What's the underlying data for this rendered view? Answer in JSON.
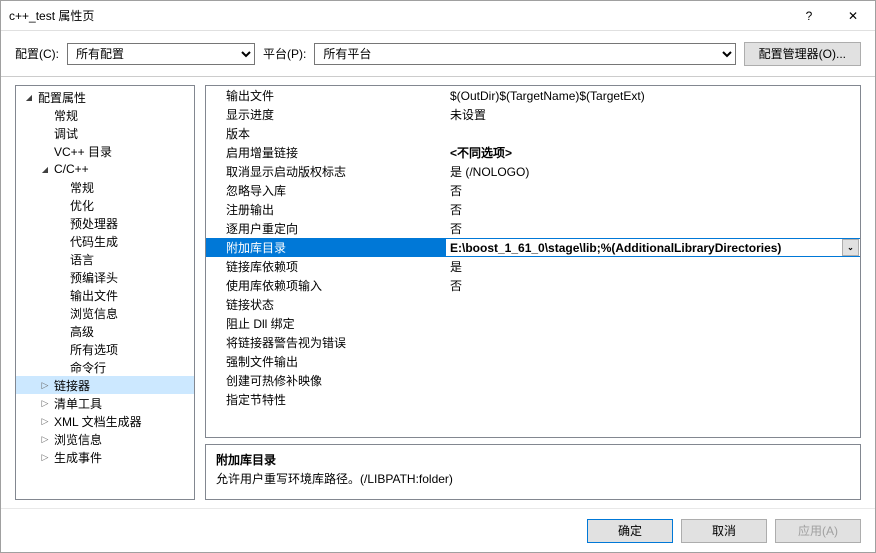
{
  "window": {
    "title": "c++_test 属性页"
  },
  "toolbar": {
    "config_label": "配置(C):",
    "config_value": "所有配置",
    "platform_label": "平台(P):",
    "platform_value": "所有平台",
    "config_mgr": "配置管理器(O)..."
  },
  "tree": [
    {
      "label": "配置属性",
      "depth": 0,
      "tw": "open"
    },
    {
      "label": "常规",
      "depth": 1,
      "tw": ""
    },
    {
      "label": "调试",
      "depth": 1,
      "tw": ""
    },
    {
      "label": "VC++ 目录",
      "depth": 1,
      "tw": ""
    },
    {
      "label": "C/C++",
      "depth": 1,
      "tw": "open"
    },
    {
      "label": "常规",
      "depth": 2,
      "tw": ""
    },
    {
      "label": "优化",
      "depth": 2,
      "tw": ""
    },
    {
      "label": "预处理器",
      "depth": 2,
      "tw": ""
    },
    {
      "label": "代码生成",
      "depth": 2,
      "tw": ""
    },
    {
      "label": "语言",
      "depth": 2,
      "tw": ""
    },
    {
      "label": "预编译头",
      "depth": 2,
      "tw": ""
    },
    {
      "label": "输出文件",
      "depth": 2,
      "tw": ""
    },
    {
      "label": "浏览信息",
      "depth": 2,
      "tw": ""
    },
    {
      "label": "高级",
      "depth": 2,
      "tw": ""
    },
    {
      "label": "所有选项",
      "depth": 2,
      "tw": ""
    },
    {
      "label": "命令行",
      "depth": 2,
      "tw": ""
    },
    {
      "label": "链接器",
      "depth": 1,
      "tw": "closed",
      "sel": true
    },
    {
      "label": "清单工具",
      "depth": 1,
      "tw": "closed"
    },
    {
      "label": "XML 文档生成器",
      "depth": 1,
      "tw": "closed"
    },
    {
      "label": "浏览信息",
      "depth": 1,
      "tw": "closed"
    },
    {
      "label": "生成事件",
      "depth": 1,
      "tw": "closed"
    }
  ],
  "props": [
    {
      "k": "输出文件",
      "v": "$(OutDir)$(TargetName)$(TargetExt)"
    },
    {
      "k": "显示进度",
      "v": "未设置"
    },
    {
      "k": "版本",
      "v": ""
    },
    {
      "k": "启用增量链接",
      "v": "<不同选项>",
      "vbold": true
    },
    {
      "k": "取消显示启动版权标志",
      "v": "是 (/NOLOGO)"
    },
    {
      "k": "忽略导入库",
      "v": "否"
    },
    {
      "k": "注册输出",
      "v": "否"
    },
    {
      "k": "逐用户重定向",
      "v": "否"
    },
    {
      "k": "附加库目录",
      "v": "E:\\boost_1_61_0\\stage\\lib;%(AdditionalLibraryDirectories)",
      "hilite": true,
      "vbold": true,
      "dd": true
    },
    {
      "k": "链接库依赖项",
      "v": "是"
    },
    {
      "k": "使用库依赖项输入",
      "v": "否"
    },
    {
      "k": "链接状态",
      "v": ""
    },
    {
      "k": "阻止 Dll 绑定",
      "v": ""
    },
    {
      "k": "将链接器警告视为错误",
      "v": ""
    },
    {
      "k": "强制文件输出",
      "v": ""
    },
    {
      "k": "创建可热修补映像",
      "v": ""
    },
    {
      "k": "指定节特性",
      "v": ""
    }
  ],
  "desc": {
    "heading": "附加库目录",
    "body": "允许用户重写环境库路径。(/LIBPATH:folder)"
  },
  "footer": {
    "ok": "确定",
    "cancel": "取消",
    "apply": "应用(A)"
  }
}
